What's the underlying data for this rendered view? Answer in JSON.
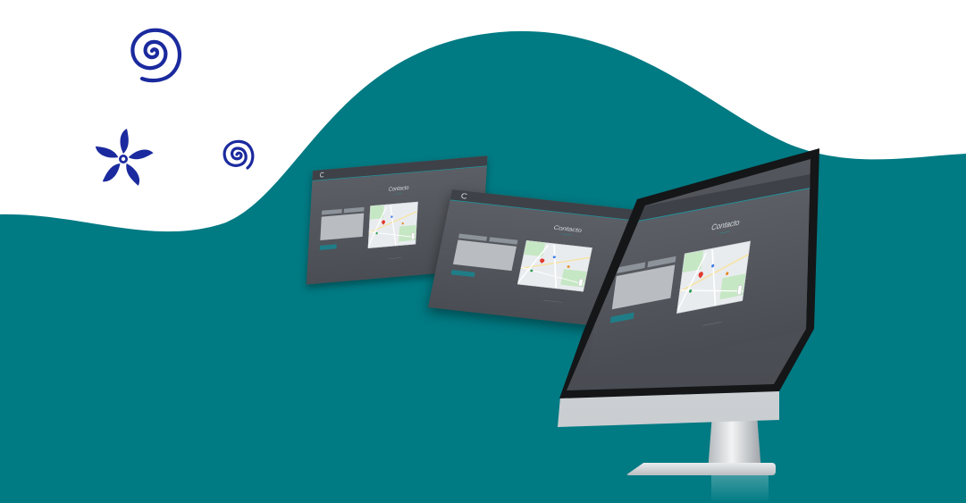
{
  "colors": {
    "background": "#ffffff",
    "wave": "#007a83",
    "decoration": "#1b2a9e",
    "site_dark": "#4a4d53",
    "site_accent": "#1f7d88"
  },
  "decorations": {
    "large_spiral_icon": "spiral-icon",
    "small_spiral_icon": "spiral-icon",
    "flower_icon": "flower-icon"
  },
  "site": {
    "page_title": "Contacto",
    "map": {
      "map_label": "Map"
    }
  }
}
